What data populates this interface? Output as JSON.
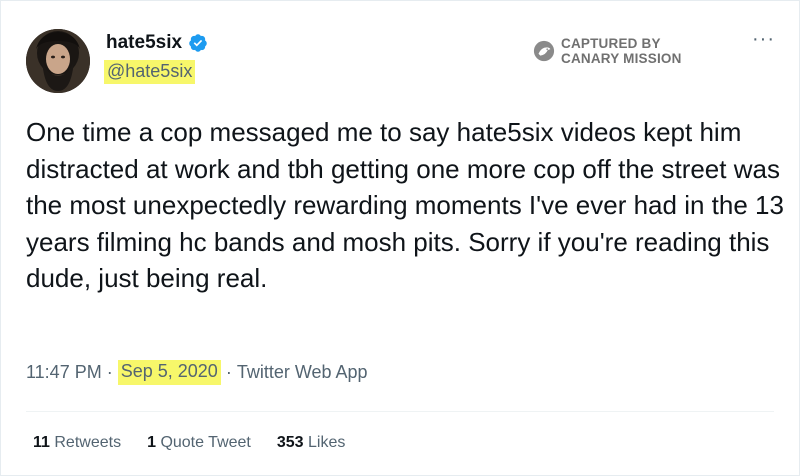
{
  "author": {
    "display_name": "hate5six",
    "handle": "@hate5six",
    "avatar_icon": "profile-photo",
    "verified_icon": "verified-badge-icon",
    "verified_color": "#1d9bf0"
  },
  "watermark": {
    "line1": "CAPTURED BY",
    "line2": "CANARY MISSION",
    "icon": "canary-mission-logo"
  },
  "more_label": "···",
  "tweet": {
    "text": "One time a cop messaged me to say hate5six videos kept him distracted at work and tbh getting one more cop off the street was the most unexpectedly rewarding moments I've ever had in the 13 years filming hc bands and mosh pits. Sorry if you're reading this dude, just being real."
  },
  "meta": {
    "time": "11:47 PM",
    "sep": " · ",
    "date": "Sep 5, 2020",
    "source": "Twitter Web App"
  },
  "stats": {
    "retweets_count": "11",
    "retweets_label": "Retweets",
    "quotes_count": "1",
    "quotes_label": "Quote Tweet",
    "likes_count": "353",
    "likes_label": "Likes"
  },
  "colors": {
    "highlight": "#f7f76a",
    "text": "#0f1419",
    "secondary": "#536471"
  }
}
